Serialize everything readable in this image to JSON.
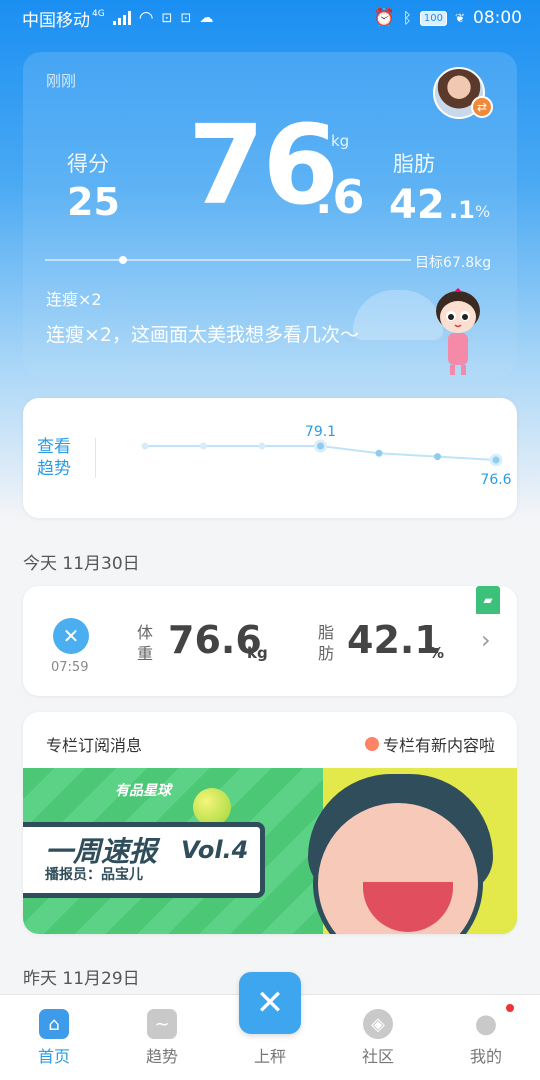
{
  "status_bar": {
    "carrier": "中国移动",
    "network": "4G",
    "battery": "100",
    "time": "08:00"
  },
  "main": {
    "time_ago": "刚刚",
    "score_label": "得分",
    "score": "25",
    "weight_int": "76",
    "weight_dec": ".6",
    "weight_unit": "kg",
    "fat_label": "脂肪",
    "fat_int": "42",
    "fat_dec": ".1",
    "fat_unit": "%",
    "goal": "目标67.8kg",
    "streak_small": "连瘦×2",
    "streak_msg": "连瘦×2，这画面太美我想多看几次～"
  },
  "trend": {
    "label": "查看趋势",
    "chart_data": {
      "type": "line",
      "values": [
        79.1,
        79.1,
        79.1,
        79.1,
        77.8,
        77.2,
        76.6
      ],
      "labels": [
        "",
        "",
        "",
        "79.1",
        "",
        "",
        "76.6"
      ]
    }
  },
  "today": {
    "date": "今天 11月30日",
    "time": "07:59",
    "weight_label": "体重",
    "weight": "76.6",
    "weight_unit": "kg",
    "fat_label": "脂肪",
    "fat": "42.1",
    "fat_unit": "%"
  },
  "column": {
    "title": "专栏订阅消息",
    "new_content": "专栏有新内容啦",
    "banner_planet": "有品星球",
    "banner_title": "一周速报",
    "banner_vol": "Vol.4",
    "banner_host": "播报员：品宝儿"
  },
  "yesterday": {
    "date": "昨天 11月29日"
  },
  "nav": {
    "home": "首页",
    "trend": "趋势",
    "weigh": "上秤",
    "community": "社区",
    "mine": "我的"
  }
}
